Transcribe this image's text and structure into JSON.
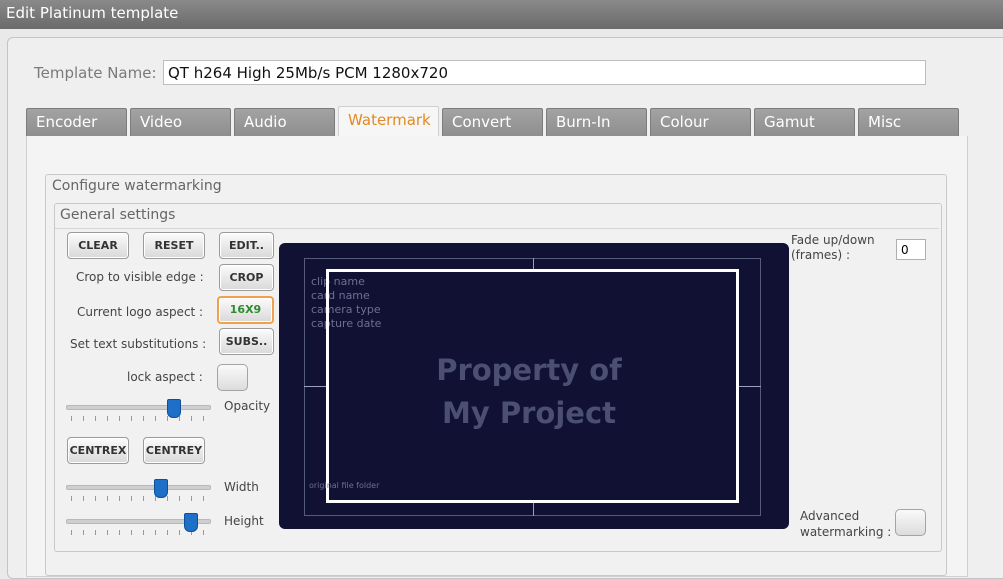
{
  "window": {
    "title": "Edit Platinum template"
  },
  "template_name": {
    "label": "Template Name:",
    "value": "QT h264 High 25Mb/s PCM 1280x720"
  },
  "tabs": [
    "Encoder",
    "Video",
    "Audio",
    "Watermark",
    "Convert",
    "Burn-In",
    "Colour",
    "Gamut",
    "Misc"
  ],
  "active_tab": "Watermark",
  "group_configure": {
    "title": "Configure watermarking"
  },
  "group_general": {
    "title": "General settings"
  },
  "buttons": {
    "clear": "CLEAR",
    "reset": "RESET",
    "edit": "EDIT..",
    "crop": "CROP",
    "aspect": "16X9",
    "subs": "SUBS..",
    "centrex": "CENTREX",
    "centrey": "CENTREY"
  },
  "labels": {
    "crop": "Crop to visible edge :",
    "aspect": "Current logo aspect :",
    "subs": "Set text substitutions :",
    "lock": "lock aspect :",
    "opacity": "Opacity",
    "width": "Width",
    "height": "Height"
  },
  "sliders": {
    "opacity": 0.75,
    "width": 0.66,
    "height": 0.87
  },
  "preview": {
    "meta_lines": [
      "clip name",
      "card name",
      "camera type",
      "capture date"
    ],
    "watermark_line1": "Property of",
    "watermark_line2": "My Project",
    "footer_text": "original file folder"
  },
  "fade": {
    "label_line1": "Fade up/down",
    "label_line2": "(frames) :",
    "value": "0"
  },
  "advanced": {
    "label_line1": "Advanced",
    "label_line2": "watermarking :"
  },
  "colors": {
    "accent": "#e28a23",
    "preview_bg": "#111133",
    "slider_thumb": "#1d6fc7"
  }
}
